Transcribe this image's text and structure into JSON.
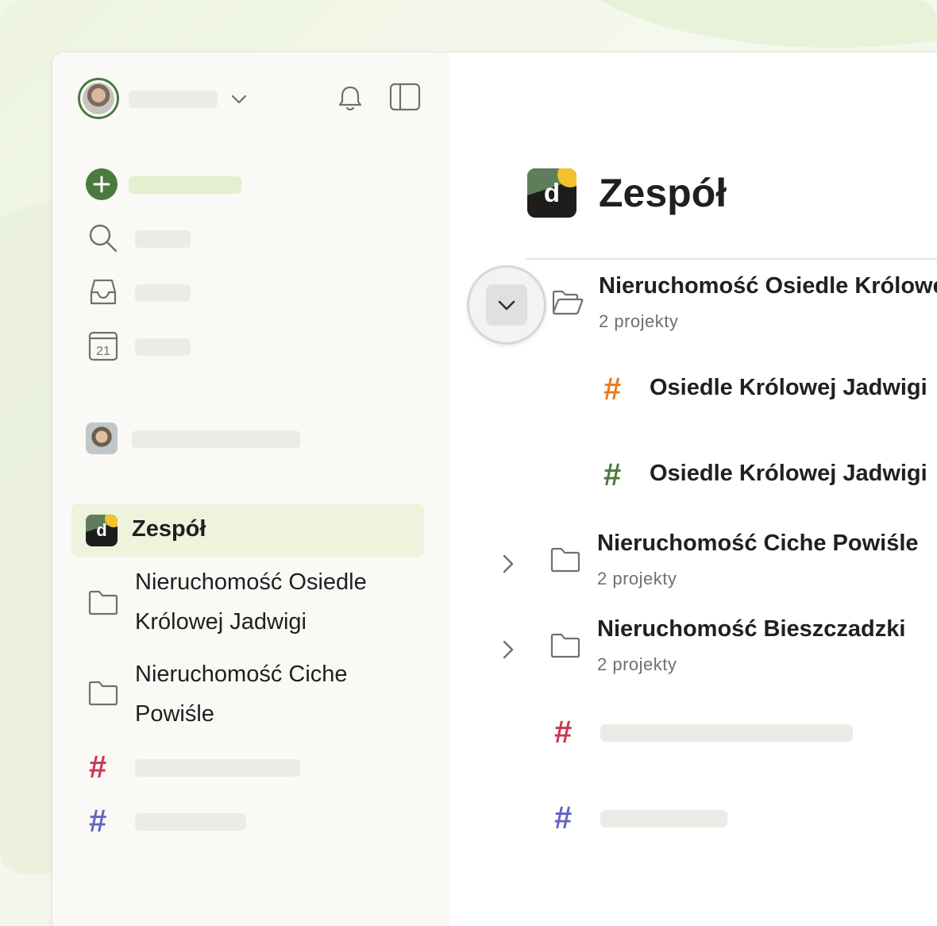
{
  "sidebar": {
    "team": {
      "label": "Zespół"
    },
    "folders": [
      {
        "label": "Nieruchomość Osiedle Królowej Jadwigi"
      },
      {
        "label": "Nieruchomość Ciche Powiśle"
      }
    ],
    "project_hash_colors": [
      "#c8384f",
      "#6563c5"
    ]
  },
  "main": {
    "title": "Zespół",
    "folders": [
      {
        "name": "Nieruchomość Osiedle Królowej Jadwigi",
        "subtitle": "2 projekty",
        "expanded": true,
        "projects": [
          {
            "name": "Osiedle Królowej Jadwigi",
            "color": "#e87a1f"
          },
          {
            "name": "Osiedle Królowej Jadwigi",
            "color": "#4a7a3e"
          }
        ]
      },
      {
        "name": "Nieruchomość Ciche Powiśle",
        "subtitle": "2 projekty",
        "expanded": false
      },
      {
        "name": "Nieruchomość Bieszczadzki",
        "subtitle": "2 projekty",
        "expanded": false
      }
    ],
    "project_hash_colors": [
      "#c8384f",
      "#6563c5"
    ]
  },
  "colors": {
    "accent": "#4b7a3f",
    "active_bg": "#eef3dc"
  }
}
